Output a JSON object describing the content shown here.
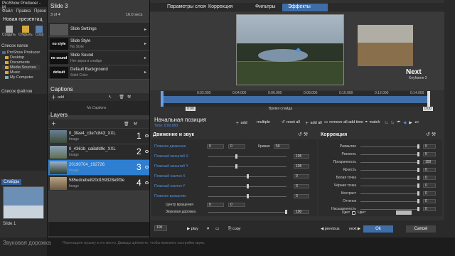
{
  "app": {
    "title": "ProShow Producer - M",
    "menu": [
      "Файл",
      "Правка",
      "Презе"
    ],
    "project_name": "Новая презентац",
    "toolbar": [
      "Создать",
      "Открыть",
      "Сохр"
    ],
    "folders_heading": "Список папок",
    "folders": [
      "ProShow Producer",
      "Desktop",
      "Documents",
      "Media Sources",
      "Music",
      "My Computer"
    ],
    "files_heading": "Список файлов",
    "slides_tab": "Слайды",
    "slide_label": "Slide 1",
    "audio_track": "Звуковая дорожка",
    "audio_hint": "Перетащите музыку в это место. Дважды щёлкните, чтобы изменить настройки звука."
  },
  "left_panel": {
    "title": "Slide 3",
    "count": "3 of 4",
    "time": "16.0 secs",
    "rows": [
      {
        "title": "Slide Settings",
        "sub": "",
        "thumb": ""
      },
      {
        "title": "Slide Style",
        "sub": "No Style",
        "thumb": "no style"
      },
      {
        "title": "Slide Sound",
        "sub": "Нет звука в слайде",
        "thumb": "no sound"
      },
      {
        "title": "Default Background",
        "sub": "Solid Color",
        "thumb": "default"
      }
    ],
    "captions_heading": "Captions",
    "captions_add": "add",
    "no_captions": "No Captions",
    "layers_heading": "Layers",
    "layers": [
      {
        "name": "0_3fee4_c3e7c843_XXL",
        "type": "Image",
        "num": "1"
      },
      {
        "name": "0_4361b_ca8afd9c_XXL",
        "type": "Image",
        "num": "2"
      },
      {
        "name": "20190704_192726",
        "type": "Image",
        "num": "3"
      },
      {
        "name": "585edcebe820d159328e9f3e",
        "type": "Image",
        "num": "4"
      }
    ]
  },
  "dialog": {
    "tabs": [
      "Параметры слоя",
      "Коррекция",
      "Фильтры",
      "Эффекты"
    ],
    "active_tab": "Эффекты",
    "next_label": "Next",
    "next_keyframe": "Keyframe 2",
    "timeline_ticks": [
      "0:02.000",
      "0:04.000",
      "0:06.000",
      "0:08.000",
      "0:10.000",
      "0:12.000",
      "0:14.000"
    ],
    "timeline_label": "Время слайда",
    "timeline_start": "0:00",
    "timeline_end": "0:00",
    "position_label": "Начальная позиция",
    "position_time": "Time: 0:00.000",
    "toolbar": [
      "add",
      "multiple",
      "reset all",
      "add all",
      "remove all",
      "add time",
      "match"
    ],
    "motion_heading": "Движение и звук",
    "correction_heading": "Коррекция",
    "motion_rows": [
      {
        "label": "Плавное движение",
        "values": [
          "0",
          "0"
        ],
        "extra_label": "Кривая",
        "extra_value": "50"
      },
      {
        "label": "Плавный масштаб X",
        "values": [
          "105"
        ]
      },
      {
        "label": "Плавный масштаб Y",
        "values": [
          "105"
        ]
      },
      {
        "label": "Плавный наклон X",
        "values": [
          "0"
        ]
      },
      {
        "label": "Плавный наклон Y",
        "values": [
          "0"
        ]
      },
      {
        "label": "Плавное вращение",
        "values": [
          "0"
        ]
      },
      {
        "label": "Центр вращения",
        "values": [
          "0",
          "0"
        ]
      },
      {
        "label": "Звуковая дорожка",
        "values": [
          "100"
        ]
      }
    ],
    "correction_rows": [
      {
        "label": "Размытие",
        "value": "0"
      },
      {
        "label": "Резкость",
        "value": "0"
      },
      {
        "label": "Прозрачность",
        "value": "100"
      },
      {
        "label": "Яркость",
        "value": "0"
      },
      {
        "label": "Белая точка",
        "value": "0"
      },
      {
        "label": "Чёрная точка",
        "value": "0"
      },
      {
        "label": "Контраст",
        "value": "0"
      },
      {
        "label": "Оттенок",
        "value": "0"
      },
      {
        "label": "Насыщенность",
        "value": "0"
      }
    ],
    "color_label": "Цвет",
    "color_check": "Цвет",
    "zoom_value": "100",
    "play": "play",
    "copy": "copy",
    "previous": "previous",
    "next": "next",
    "ok": "Ok",
    "cancel": "Cancel"
  }
}
